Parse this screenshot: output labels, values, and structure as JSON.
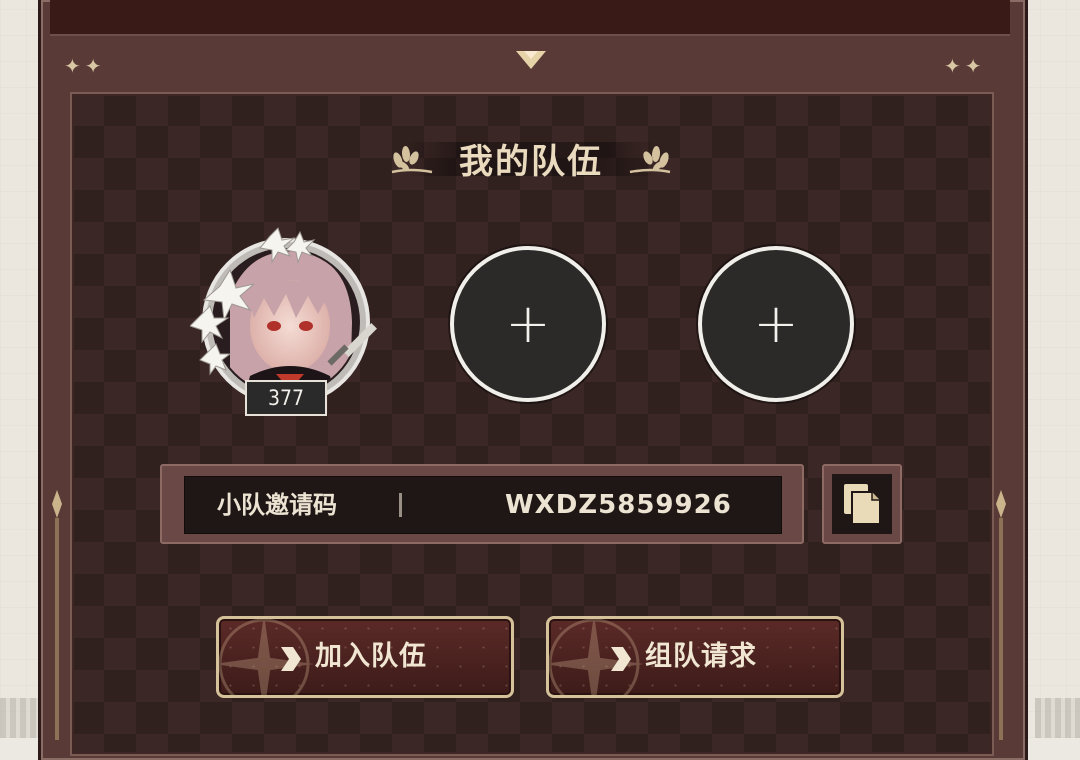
{
  "panel": {
    "title": "我的队伍",
    "stars": "✦✦"
  },
  "team": {
    "leader": {
      "level": "377"
    },
    "empty_slot_symbol": "+"
  },
  "invite": {
    "label": "小队邀请码",
    "code": "WXDZ5859926"
  },
  "actions": {
    "join_label": "加入队伍",
    "request_label": "组队请求"
  },
  "colors": {
    "accent_gold": "#d6c29a",
    "panel_dark": "#3b2725",
    "button_red": "#5b2a27"
  },
  "icons": {
    "copy": "copy-icon",
    "collapse": "chevron-down-icon",
    "laurel": "laurel-icon"
  }
}
